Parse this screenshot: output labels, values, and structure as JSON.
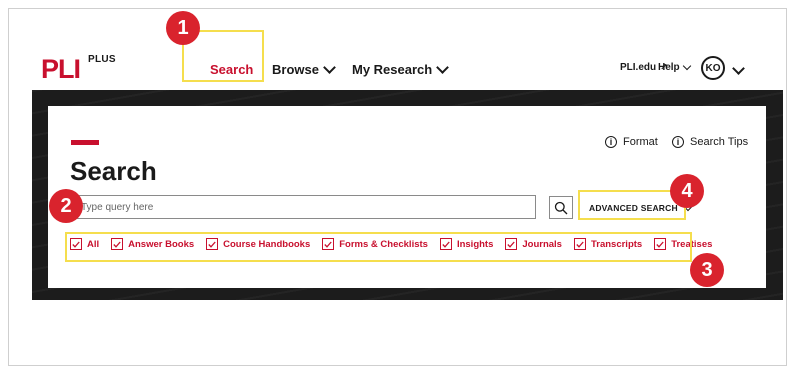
{
  "header": {
    "logo_text": "PLI",
    "logo_sup": "PLUS",
    "nav": [
      {
        "label": "Search",
        "active": true
      },
      {
        "label": "Browse"
      },
      {
        "label": "My Research"
      }
    ],
    "pli_edu_label": "PLI.edu",
    "pli_edu_icon": "↗",
    "help_label": "Help",
    "avatar_initials": "KO"
  },
  "search": {
    "title": "Search",
    "format_label": "Format",
    "tips_label": "Search Tips",
    "input_placeholder": "Type query here",
    "advanced_label": "ADVANCED SEARCH",
    "filters": [
      "All",
      "Answer Books",
      "Course Handbooks",
      "Forms & Checklists",
      "Insights",
      "Journals",
      "Transcripts",
      "Treatises"
    ]
  },
  "annotations": {
    "badges": [
      "1",
      "2",
      "3",
      "4"
    ],
    "highlight_color": "#f5de4d",
    "badge_color": "#d9232d"
  },
  "colors": {
    "brand_red": "#c8102e",
    "band_dark": "#1c1c1c"
  }
}
